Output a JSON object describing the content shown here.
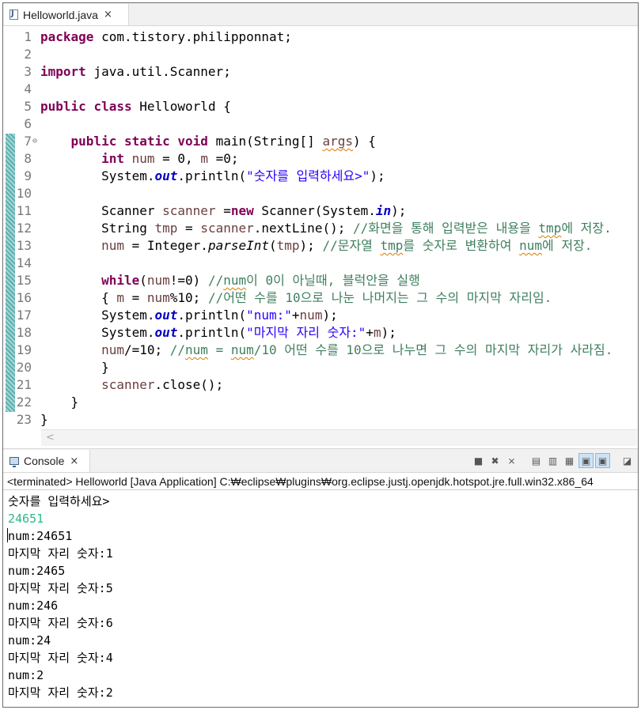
{
  "editor": {
    "tab_label": "Helloworld.java",
    "close_glyph": "×",
    "lines": [
      {
        "n": "1",
        "t": [
          {
            "k": "kw",
            "v": "package"
          },
          {
            "v": " com.tistory.philipponnat;"
          }
        ]
      },
      {
        "n": "2",
        "t": []
      },
      {
        "n": "3",
        "t": [
          {
            "k": "kw",
            "v": "import"
          },
          {
            "v": " java.util.Scanner;"
          }
        ]
      },
      {
        "n": "4",
        "t": []
      },
      {
        "n": "5",
        "t": [
          {
            "k": "kw",
            "v": "public"
          },
          {
            "v": " "
          },
          {
            "k": "kw",
            "v": "class"
          },
          {
            "v": " Helloworld {"
          }
        ]
      },
      {
        "n": "6",
        "t": []
      },
      {
        "n": "7",
        "fold": "⊖",
        "t": [
          {
            "v": "    "
          },
          {
            "k": "kw",
            "v": "public"
          },
          {
            "v": " "
          },
          {
            "k": "kw",
            "v": "static"
          },
          {
            "v": " "
          },
          {
            "k": "kw",
            "v": "void"
          },
          {
            "v": " main(String[] "
          },
          {
            "k": "var sq",
            "v": "args"
          },
          {
            "v": ") {"
          }
        ]
      },
      {
        "n": "8",
        "t": [
          {
            "v": "        "
          },
          {
            "k": "kw",
            "v": "int"
          },
          {
            "v": " "
          },
          {
            "k": "var",
            "v": "num"
          },
          {
            "v": " = 0, "
          },
          {
            "k": "var",
            "v": "m"
          },
          {
            "v": " =0;"
          }
        ]
      },
      {
        "n": "9",
        "t": [
          {
            "v": "        System."
          },
          {
            "k": "fld",
            "v": "out"
          },
          {
            "v": ".println("
          },
          {
            "k": "str",
            "v": "\"숫자를 입력하세요>\""
          },
          {
            "v": ");"
          }
        ]
      },
      {
        "n": "10",
        "t": []
      },
      {
        "n": "11",
        "t": [
          {
            "v": "        Scanner "
          },
          {
            "k": "var",
            "v": "scanner"
          },
          {
            "v": " ="
          },
          {
            "k": "kw",
            "v": "new"
          },
          {
            "v": " Scanner(System."
          },
          {
            "k": "fld",
            "v": "in"
          },
          {
            "v": ");"
          }
        ]
      },
      {
        "n": "12",
        "t": [
          {
            "v": "        String "
          },
          {
            "k": "var",
            "v": "tmp"
          },
          {
            "v": " = "
          },
          {
            "k": "var",
            "v": "scanner"
          },
          {
            "v": ".nextLine(); "
          },
          {
            "k": "cm",
            "v": "//화면을 통해 입력받은 내용을 "
          },
          {
            "k": "cm sq",
            "v": "tmp"
          },
          {
            "k": "cm",
            "v": "에 저장."
          }
        ]
      },
      {
        "n": "13",
        "t": [
          {
            "v": "        "
          },
          {
            "k": "var",
            "v": "num"
          },
          {
            "v": " = Integer."
          },
          {
            "k": "it",
            "v": "parseInt"
          },
          {
            "v": "("
          },
          {
            "k": "var",
            "v": "tmp"
          },
          {
            "v": "); "
          },
          {
            "k": "cm",
            "v": "//문자열 "
          },
          {
            "k": "cm sq",
            "v": "tmp"
          },
          {
            "k": "cm",
            "v": "를 숫자로 변환하여 "
          },
          {
            "k": "cm sq",
            "v": "num"
          },
          {
            "k": "cm",
            "v": "에 저장."
          }
        ]
      },
      {
        "n": "14",
        "t": []
      },
      {
        "n": "15",
        "t": [
          {
            "v": "        "
          },
          {
            "k": "kw",
            "v": "while"
          },
          {
            "v": "("
          },
          {
            "k": "var",
            "v": "num"
          },
          {
            "v": "!=0) "
          },
          {
            "k": "cm",
            "v": "//"
          },
          {
            "k": "cm sq",
            "v": "num"
          },
          {
            "k": "cm",
            "v": "이 0이 아닐때, 블럭안을 실행"
          }
        ]
      },
      {
        "n": "16",
        "t": [
          {
            "v": "        { "
          },
          {
            "k": "var",
            "v": "m"
          },
          {
            "v": " = "
          },
          {
            "k": "var",
            "v": "num"
          },
          {
            "v": "%10; "
          },
          {
            "k": "cm",
            "v": "//어떤 수를 10으로 나눈 나머지는 그 수의 마지막 자리임."
          }
        ]
      },
      {
        "n": "17",
        "t": [
          {
            "v": "        System."
          },
          {
            "k": "fld",
            "v": "out"
          },
          {
            "v": ".println("
          },
          {
            "k": "str",
            "v": "\"num:\""
          },
          {
            "v": "+"
          },
          {
            "k": "var",
            "v": "num"
          },
          {
            "v": ");"
          }
        ]
      },
      {
        "n": "18",
        "t": [
          {
            "v": "        System."
          },
          {
            "k": "fld",
            "v": "out"
          },
          {
            "v": ".println("
          },
          {
            "k": "str",
            "v": "\"마지막 자리 숫자:\""
          },
          {
            "v": "+"
          },
          {
            "k": "var",
            "v": "m"
          },
          {
            "v": ");"
          }
        ]
      },
      {
        "n": "19",
        "t": [
          {
            "v": "        "
          },
          {
            "k": "var",
            "v": "num"
          },
          {
            "v": "/=10; "
          },
          {
            "k": "cm",
            "v": "//"
          },
          {
            "k": "cm sq",
            "v": "num"
          },
          {
            "k": "cm",
            "v": " = "
          },
          {
            "k": "cm sq",
            "v": "num"
          },
          {
            "k": "cm",
            "v": "/10 어떤 수를 10으로 나누면 그 수의 마지막 자리가 사라짐."
          }
        ]
      },
      {
        "n": "20",
        "t": [
          {
            "v": "        }"
          }
        ]
      },
      {
        "n": "21",
        "t": [
          {
            "v": "        "
          },
          {
            "k": "var",
            "v": "scanner"
          },
          {
            "v": ".close();"
          }
        ]
      },
      {
        "n": "22",
        "t": [
          {
            "v": "    }"
          }
        ]
      },
      {
        "n": "23",
        "t": [
          {
            "v": "}"
          }
        ]
      }
    ],
    "scroll_arrow": "<"
  },
  "console": {
    "tab_label": "Console",
    "close_glyph": "×",
    "status": "<terminated> Helloworld [Java Application] C:₩eclipse₩plugins₩org.eclipse.justj.openjdk.hotspot.jre.full.win32.x86_64",
    "output": [
      {
        "text": "숫자를 입력하세요>",
        "type": "out"
      },
      {
        "text": "24651",
        "type": "input"
      },
      {
        "text": "num:24651",
        "type": "out"
      },
      {
        "text": "마지막 자리 숫자:1",
        "type": "out"
      },
      {
        "text": "num:2465",
        "type": "out"
      },
      {
        "text": "마지막 자리 숫자:5",
        "type": "out"
      },
      {
        "text": "num:246",
        "type": "out"
      },
      {
        "text": "마지막 자리 숫자:6",
        "type": "out"
      },
      {
        "text": "num:24",
        "type": "out"
      },
      {
        "text": "마지막 자리 숫자:4",
        "type": "out"
      },
      {
        "text": "num:2",
        "type": "out"
      },
      {
        "text": "마지막 자리 숫자:2",
        "type": "out"
      }
    ],
    "toolbar": [
      {
        "name": "terminate-icon",
        "glyph": "■"
      },
      {
        "name": "remove-launch-icon",
        "glyph": "✖"
      },
      {
        "name": "remove-all-terminated-icon",
        "glyph": "⨯"
      },
      {
        "name": "sep"
      },
      {
        "name": "clear-console-icon",
        "glyph": "▤"
      },
      {
        "name": "scroll-lock-icon",
        "glyph": "▥"
      },
      {
        "name": "word-wrap-icon",
        "glyph": "▦"
      },
      {
        "name": "show-on-output-icon",
        "glyph": "▣",
        "selected": true
      },
      {
        "name": "show-on-error-icon",
        "glyph": "▣",
        "selected": true
      },
      {
        "name": "sep"
      },
      {
        "name": "open-console-icon",
        "glyph": "◪"
      }
    ]
  },
  "colors": {
    "keyword": "#7f0055",
    "string": "#2a00ff",
    "comment": "#3f7f5f",
    "field": "#0000c0",
    "input": "#2db88b"
  }
}
